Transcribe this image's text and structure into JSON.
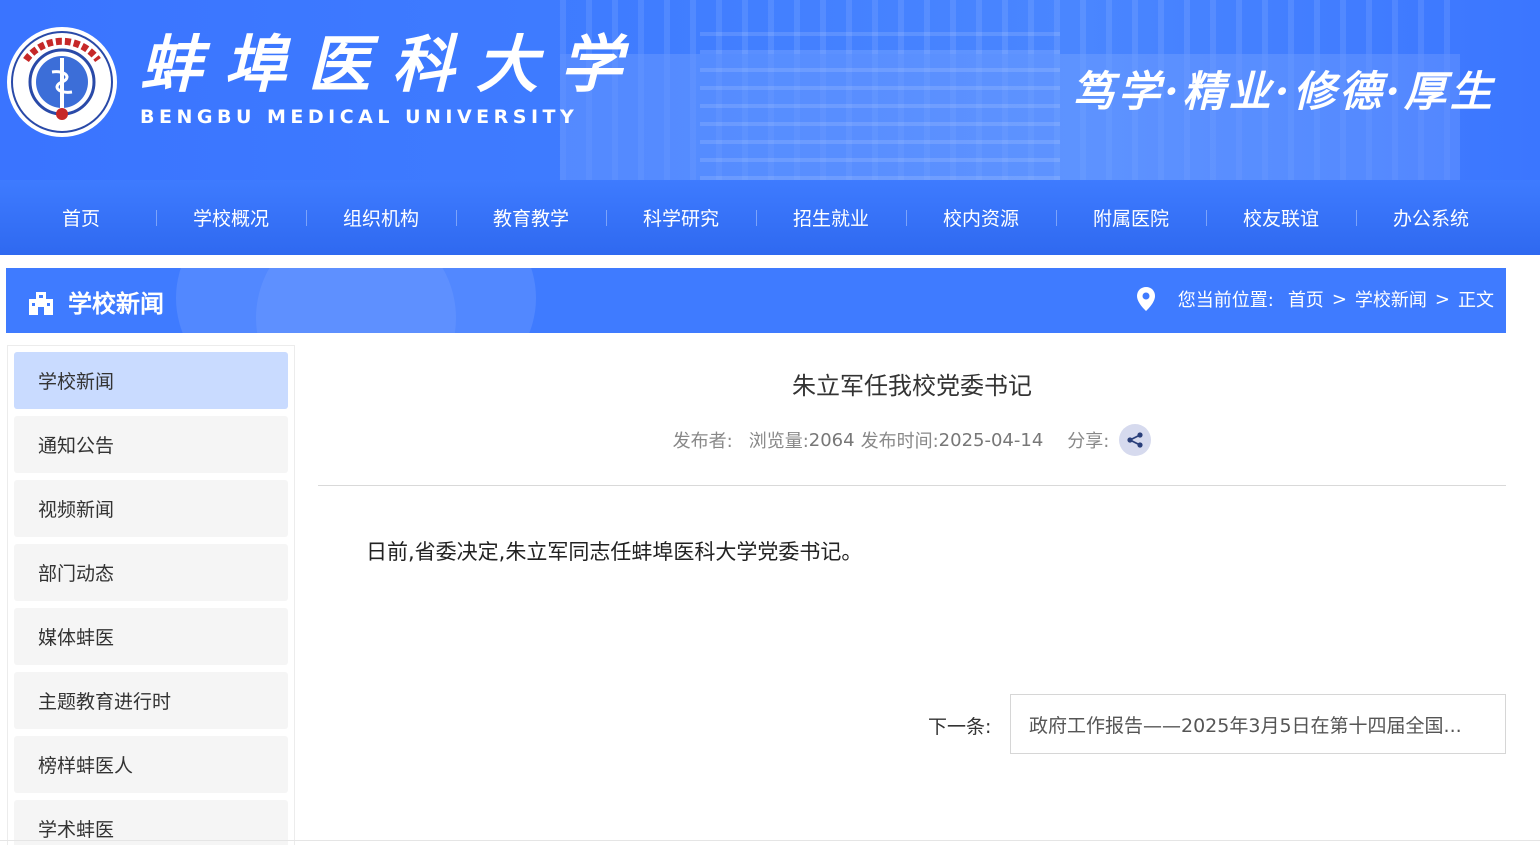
{
  "header": {
    "school_name_cn": "蚌埠医科大学",
    "school_name_en": "BENGBU MEDICAL UNIVERSITY",
    "motto": "笃学·精业·修德·厚生",
    "logo_text_cn": "蚌埠医科大学",
    "logo_text_en": "Bengbu Medical University",
    "logo_year": "1958"
  },
  "nav": {
    "items": [
      "首页",
      "学校概况",
      "组织机构",
      "教育教学",
      "科学研究",
      "招生就业",
      "校内资源",
      "附属医院",
      "校友联谊",
      "办公系统"
    ]
  },
  "section": {
    "title": "学校新闻",
    "location_label": "您当前位置:",
    "crumbs": [
      "首页",
      "学校新闻",
      "正文"
    ],
    "separator": ">"
  },
  "sidebar": {
    "items": [
      "学校新闻",
      "通知公告",
      "视频新闻",
      "部门动态",
      "媒体蚌医",
      "主题教育进行时",
      "榜样蚌医人",
      "学术蚌医"
    ],
    "active_index": 0
  },
  "article": {
    "title": "朱立军任我校党委书记",
    "publisher_label": "发布者:",
    "publisher_value": "",
    "views_label": "浏览量:",
    "views_value": "2064",
    "date_label": "发布时间:",
    "date_value": "2025-04-14",
    "share_label": "分享:",
    "body": "日前,省委决定,朱立军同志任蚌埠医科大学党委书记。",
    "next_label": "下一条:",
    "next_title": "政府工作报告——2025年3月5日在第十四届全国..."
  },
  "colors": {
    "primary": "#3f7bff",
    "nav": "#2f69f0",
    "active_side": "#c9dbff"
  }
}
